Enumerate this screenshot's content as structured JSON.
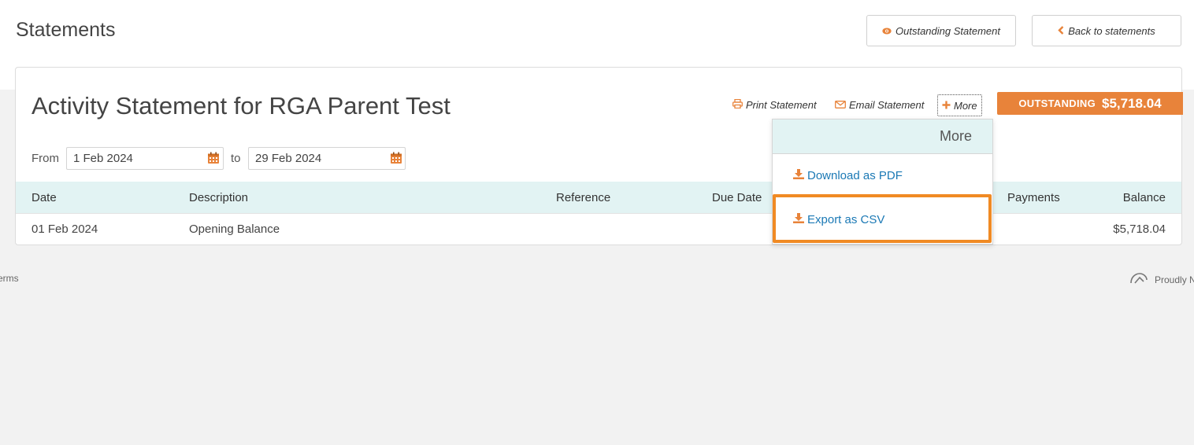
{
  "header": {
    "title": "Statements",
    "outstanding_button": "Outstanding Statement",
    "back_button": "Back to statements"
  },
  "statement": {
    "title": "Activity Statement for RGA Parent Test",
    "actions": {
      "print": "Print Statement",
      "email": "Email Statement",
      "more": "More"
    },
    "outstanding": {
      "label": "OUTSTANDING",
      "amount": "$5,718.04"
    },
    "date_range": {
      "from_label": "From",
      "from_value": "1 Feb 2024",
      "to_label": "to",
      "to_value": "29 Feb 2024"
    },
    "table": {
      "columns": [
        "Date",
        "Description",
        "Reference",
        "Due Date",
        "Payments",
        "Balance"
      ],
      "rows": [
        {
          "date": "01 Feb 2024",
          "description": "Opening Balance",
          "balance": "$5,718.04"
        }
      ]
    }
  },
  "more_menu": {
    "heading": "More",
    "items": [
      "Download as PDF",
      "Export as CSV"
    ]
  },
  "footer": {
    "left": "erms",
    "right": "Proudly N"
  },
  "colors": {
    "accent": "#e8833a",
    "link": "#1b79b5",
    "table_header": "#e2f3f3",
    "highlight": "#f08a24"
  }
}
